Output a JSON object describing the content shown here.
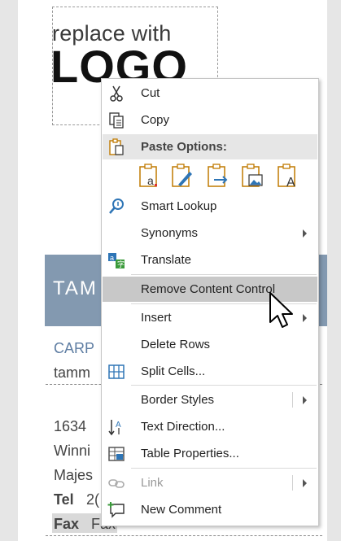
{
  "document": {
    "logo": {
      "line1": "replace with",
      "line2": "LOGO"
    },
    "name_banner": "TAM",
    "lines": [
      {
        "key": "line-title",
        "text": "CARP"
      },
      {
        "key": "line-email",
        "text": "tamm"
      },
      {
        "key": "line-address-1",
        "text": "1634"
      },
      {
        "key": "line-address-2",
        "text": "Winni"
      },
      {
        "key": "line-address-3",
        "text": "Majes"
      }
    ],
    "tel_label": "Tel",
    "tel_value": "2(",
    "fax_label": "Fax",
    "fax_value": "Fax"
  },
  "context_menu": {
    "items": {
      "cut": "Cut",
      "copy": "Copy",
      "paste_options": "Paste Options:",
      "smart_lookup": "Smart Lookup",
      "synonyms": "Synonyms",
      "translate": "Translate",
      "remove_content_control": "Remove Content Control",
      "insert": "Insert",
      "delete_rows": "Delete Rows",
      "split_cells": "Split Cells...",
      "border_styles": "Border Styles",
      "text_direction": "Text Direction...",
      "table_properties": "Table Properties...",
      "link": "Link",
      "new_comment": "New Comment"
    },
    "highlighted": "remove_content_control",
    "icons": [
      "scissors-icon",
      "copy-icon",
      "paste-icon",
      "smart-lookup-icon",
      "translate-icon",
      "split-cells-icon",
      "text-direction-icon",
      "table-properties-icon",
      "link-icon",
      "new-comment-icon"
    ],
    "paste_icons": [
      "paste-keep-source-formatting-icon",
      "paste-merge-formatting-icon",
      "paste-nested-table-icon",
      "paste-picture-icon",
      "paste-keep-text-only-icon"
    ],
    "colors": {
      "highlight": "#c8c8c8",
      "banner": "#8399b0",
      "accent_blue": "#2e75b6",
      "text_blue": "#5f7ea3"
    }
  }
}
